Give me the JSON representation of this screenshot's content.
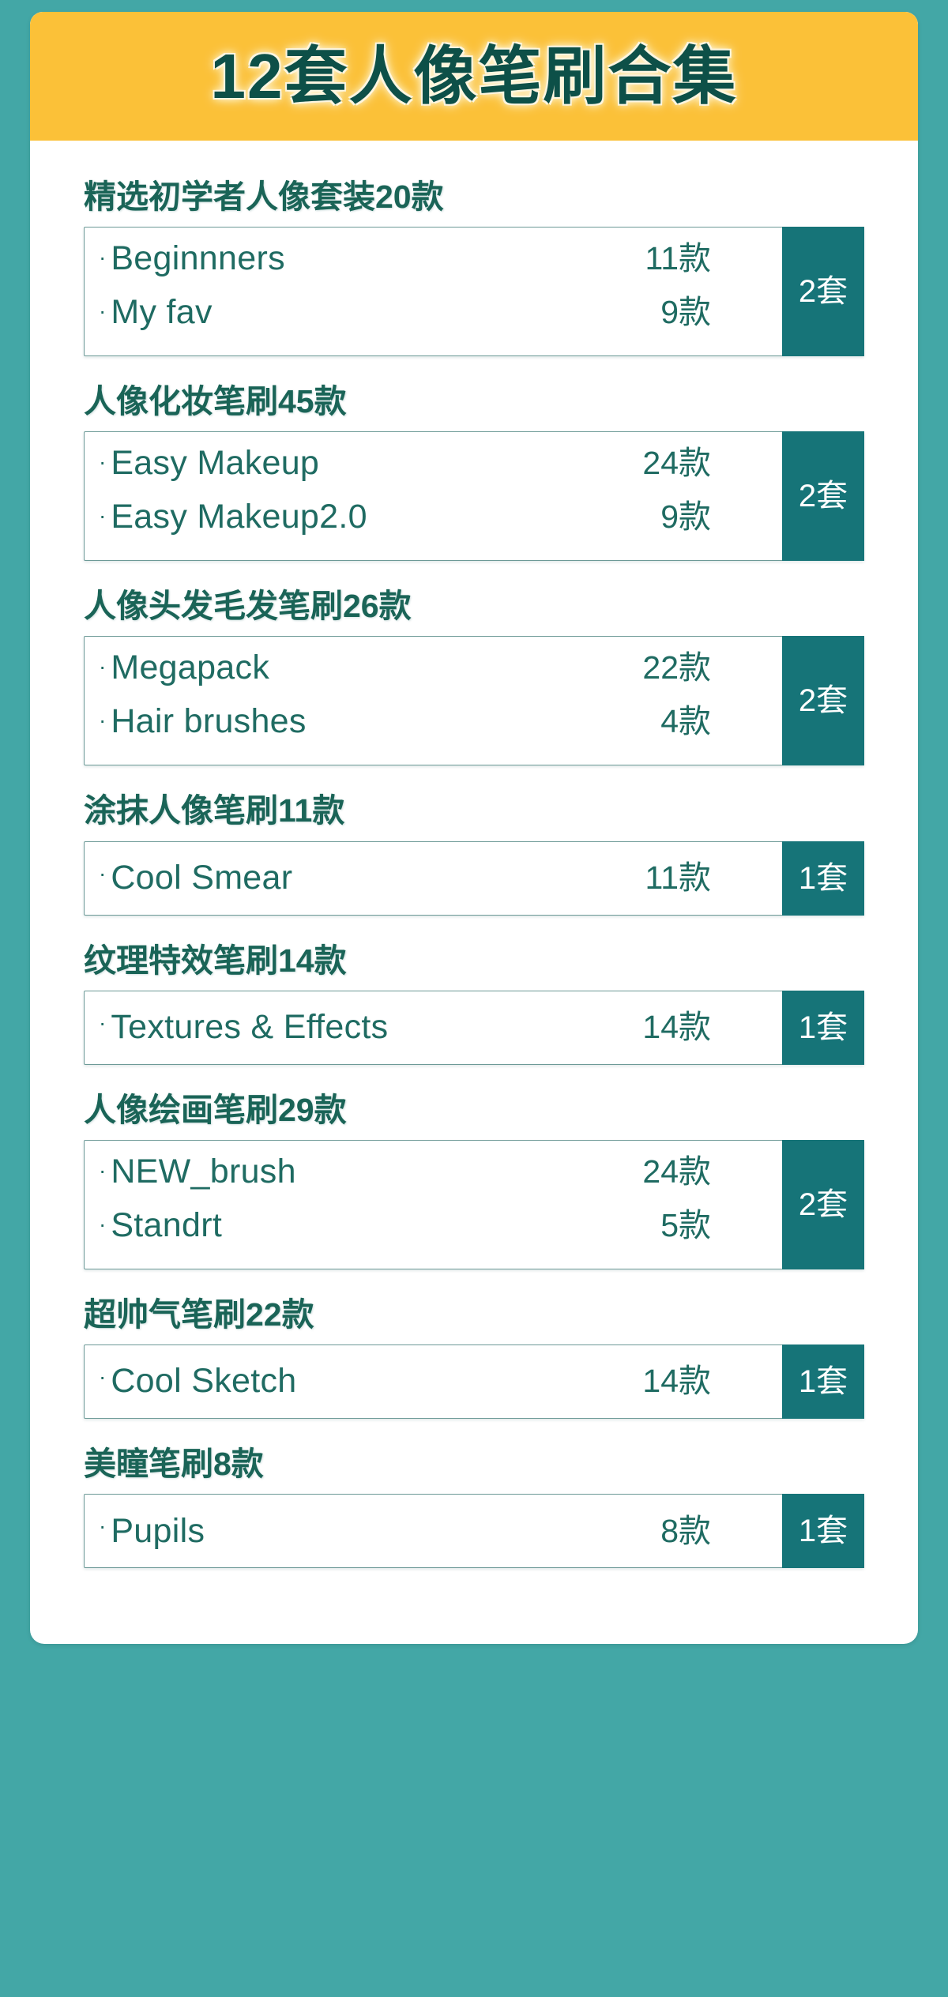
{
  "header": {
    "title": "12套人像笔刷合集",
    "banner_color": "#fbc138",
    "title_color": "#0d5048"
  },
  "theme": {
    "background": "#43a7a6",
    "card_background": "#ffffff",
    "heading_color": "#1a6457",
    "text_color": "#1f6b62",
    "badge_background": "#167478",
    "badge_text_color": "#ffffff",
    "box_border_color": "#6d9a97"
  },
  "sections": [
    {
      "title": "精选初学者人像套装20款",
      "badge": "2套",
      "rows": [
        {
          "bullet": "·",
          "name": "Beginnners",
          "count": "11款"
        },
        {
          "bullet": "·",
          "name": "My fav",
          "count": "9款"
        }
      ]
    },
    {
      "title": "人像化妆笔刷45款",
      "badge": "2套",
      "rows": [
        {
          "bullet": "·",
          "name": "Easy Makeup",
          "count": "24款"
        },
        {
          "bullet": "·",
          "name": "Easy Makeup2.0",
          "count": "9款"
        }
      ]
    },
    {
      "title": "人像头发毛发笔刷26款",
      "badge": "2套",
      "rows": [
        {
          "bullet": "·",
          "name": "Megapack",
          "count": "22款"
        },
        {
          "bullet": "·",
          "name": "Hair brushes",
          "count": "4款"
        }
      ]
    },
    {
      "title": "涂抹人像笔刷11款",
      "badge": "1套",
      "rows": [
        {
          "bullet": "·",
          "name": "Cool Smear",
          "count": "11款"
        }
      ]
    },
    {
      "title": "纹理特效笔刷14款",
      "badge": "1套",
      "rows": [
        {
          "bullet": "·",
          "name": "Textures & Effects",
          "count": "14款"
        }
      ]
    },
    {
      "title": "人像绘画笔刷29款",
      "badge": "2套",
      "rows": [
        {
          "bullet": "·",
          "name": "NEW_brush",
          "count": "24款"
        },
        {
          "bullet": "·",
          "name": "Standrt",
          "count": "5款"
        }
      ]
    },
    {
      "title": "超帅气笔刷22款",
      "badge": "1套",
      "rows": [
        {
          "bullet": "·",
          "name": "Cool Sketch",
          "count": "14款"
        }
      ]
    },
    {
      "title": "美瞳笔刷8款",
      "badge": "1套",
      "rows": [
        {
          "bullet": "·",
          "name": "Pupils",
          "count": "8款"
        }
      ]
    }
  ]
}
